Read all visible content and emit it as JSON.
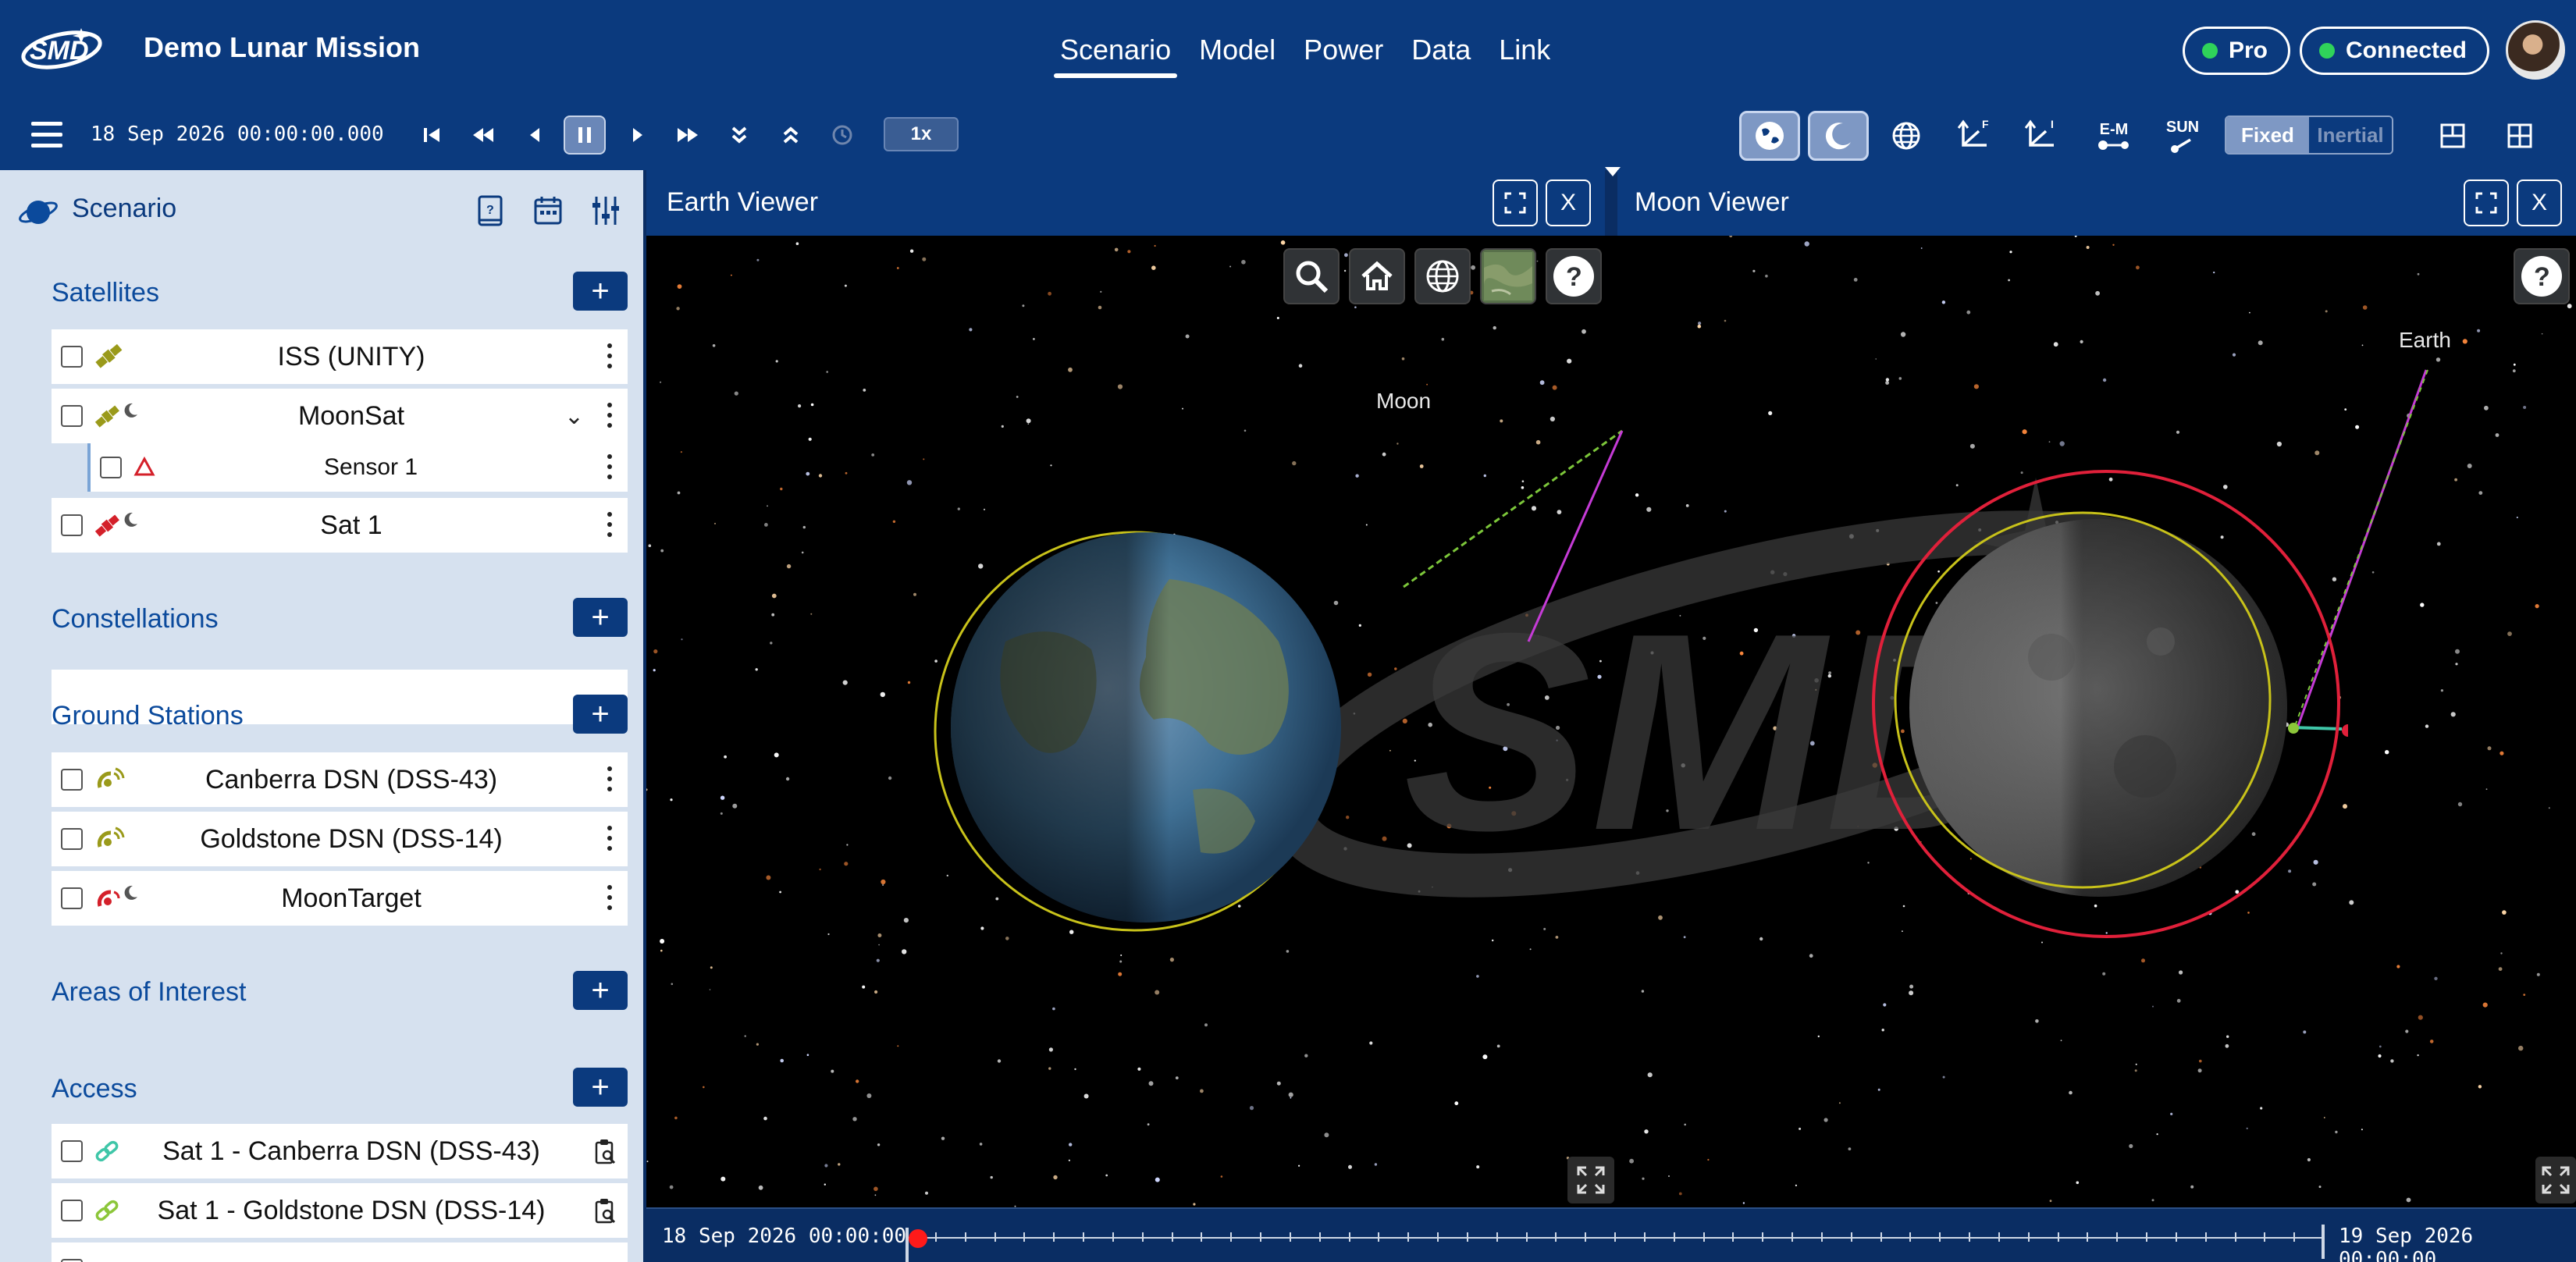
{
  "header": {
    "app_title": "Demo Lunar Mission",
    "tabs": [
      {
        "label": "Scenario",
        "active": true
      },
      {
        "label": "Model"
      },
      {
        "label": "Power"
      },
      {
        "label": "Data"
      },
      {
        "label": "Link"
      }
    ],
    "plan_badge": "Pro",
    "connection_badge": "Connected",
    "status_color": "#2fd35a"
  },
  "toolbar": {
    "sim_time": "18 Sep 2026 00:00:00.000",
    "speed": "1x",
    "icons": [
      "skip-start-icon",
      "rewind-icon",
      "step-back-icon",
      "pause-icon",
      "step-forward-icon",
      "fast-forward-icon",
      "chevrons-down-icon",
      "chevrons-up-icon",
      "clock-icon"
    ],
    "view_tools": {
      "em_label": "E-M",
      "sun_label": "SUN",
      "f_label": "F",
      "i_label": "I"
    },
    "frame_options": [
      "Fixed",
      "Inertial"
    ],
    "frame_selected": "Fixed"
  },
  "sidebar": {
    "title": "Scenario",
    "sections": {
      "satellites": {
        "title": "Satellites",
        "items": [
          {
            "label": "ISS (UNITY)"
          },
          {
            "label": "MoonSat"
          },
          {
            "label": "Sensor 1"
          },
          {
            "label": "Sat 1"
          }
        ]
      },
      "constellations": {
        "title": "Constellations"
      },
      "ground_stations": {
        "title": "Ground Stations",
        "items": [
          {
            "label": "Canberra DSN (DSS-43)"
          },
          {
            "label": "Goldstone DSN (DSS-14)"
          },
          {
            "label": "MoonTarget"
          }
        ]
      },
      "areas": {
        "title": "Areas of Interest"
      },
      "access": {
        "title": "Access",
        "items": [
          {
            "label": "Sat 1 - Canberra DSN (DSS-43)"
          },
          {
            "label": "Sat 1 - Goldstone DSN (DSS-14)"
          }
        ]
      }
    }
  },
  "earth_viewer": {
    "title": "Earth Viewer",
    "close_label": "X",
    "body_label": "Moon"
  },
  "moon_viewer": {
    "title": "Moon Viewer",
    "close_label": "X",
    "body_label": "Earth"
  },
  "timeline": {
    "start": "18 Sep 2026 00:00:00",
    "end": "19 Sep 2026 00:00:00",
    "progress": 0.0
  },
  "colors": {
    "brand_blue": "#0b3a7e",
    "sidebar_bg": "#d6e1ef",
    "orbit_yellow": "#c8c21a",
    "orbit_red": "#e0203a",
    "link_magenta": "#c53bd6",
    "link_green": "#7cc63a"
  }
}
